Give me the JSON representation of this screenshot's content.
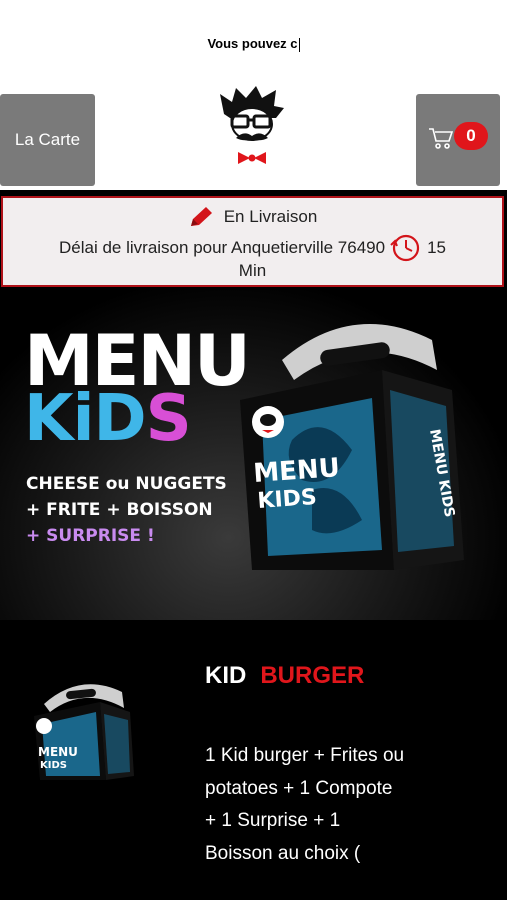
{
  "header": {
    "ticker_text": "Vous pouvez c",
    "menu_button_label": "La Carte",
    "cart_count": "0"
  },
  "delivery": {
    "mode": "En Livraison",
    "delay_text": "Délai de livraison pour Anquetierville 76490",
    "delay_value": "15",
    "delay_unit": "Min"
  },
  "banner": {
    "title_line1": "MENU",
    "title_line2_a": "KiD",
    "title_line2_b": "S",
    "line1": "CHEESE ou NUGGETS",
    "line2": "+ FRITE + BOISSON",
    "line3": "+ SURPRISE !",
    "box_label_1": "MENU",
    "box_label_2": "KIDS"
  },
  "product": {
    "title_part1": "KID",
    "title_part2": "BURGER",
    "description": "1 Kid burger  + Frites ou potatoes + 1 Compote  + 1 Surprise  + 1 Boisson au choix (",
    "thumb_label_1": "MENU",
    "thumb_label_2": "KIDS"
  },
  "colors": {
    "accent_red": "#e0161b",
    "button_grey": "#7a7a7a",
    "kids_blue": "#3fb6e8",
    "kids_pink": "#d84fd6"
  }
}
